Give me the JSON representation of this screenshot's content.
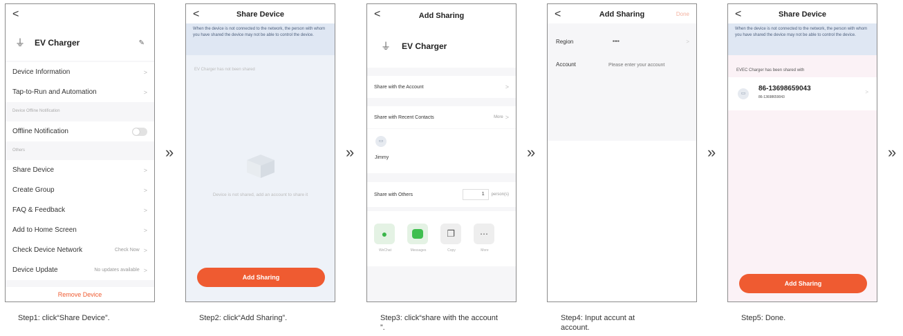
{
  "arrow_glyph": "»",
  "back_glyph": "<",
  "chevron_glyph": ">",
  "screens": {
    "s1": {
      "device_name": "EV Charger",
      "rows": [
        {
          "label": "Device Information"
        },
        {
          "label": "Tap-to-Run and Automation"
        }
      ],
      "offline_group": "Device Offline Notification",
      "offline_label": "Offline Notification",
      "others_group": "Others",
      "others": [
        {
          "label": "Share Device",
          "right": ""
        },
        {
          "label": "Create Group",
          "right": ""
        },
        {
          "label": "FAQ & Feedback",
          "right": ""
        },
        {
          "label": "Add to Home Screen",
          "right": ""
        },
        {
          "label": "Check Device Network",
          "right": "Check Now"
        },
        {
          "label": "Device Update",
          "right": "No updates available"
        }
      ],
      "remove_label": "Remove Device",
      "caption": "Step1: click“Share Device”."
    },
    "s2": {
      "title": "Share Device",
      "notice": "When the device is not connected to the network, the person with whom you have shared the device may not be able to control the device.",
      "not_shared_hint": "EV Charger has not been shared",
      "empty_hint": "Device is not shared, add an account to share it",
      "button": "Add Sharing",
      "caption": "Step2: click“Add Sharing”."
    },
    "s3": {
      "title": "Add Sharing",
      "device_name": "EV Charger",
      "share_account": "Share with the Account",
      "recent_contacts": "Share with Recent Contacts",
      "more": "More",
      "contact_name": "Jimmy",
      "share_others": "Share with Others",
      "persons_value": "1",
      "persons_unit": "person(s)",
      "apps": [
        {
          "label": "WeChat",
          "icon": "wechat-icon"
        },
        {
          "label": "Messages",
          "icon": "messages-icon"
        },
        {
          "label": "Copy",
          "icon": "copy-icon"
        },
        {
          "label": "More",
          "icon": "more-icon"
        }
      ],
      "caption": "Step3: click“share with the account ”."
    },
    "s4": {
      "title": "Add Sharing",
      "done": "Done",
      "region_label": "Region",
      "region_value": "••••",
      "account_label": "Account",
      "account_placeholder": "Please enter your account",
      "caption": "Step4: Input accunt at account."
    },
    "s5": {
      "title": "Share Device",
      "notice": "When the device is not connected to the network, the person with whom you have shared the device may not be able to control the device.",
      "shared_with": "EVEC Charger has been shared with",
      "account_big": "86-13698659043",
      "account_small": "86-13698659043",
      "button": "Add Sharing",
      "caption": "Step5: Done."
    }
  },
  "colors": {
    "accent": "#ef5b31",
    "notice_bg": "#dfe7f3"
  }
}
